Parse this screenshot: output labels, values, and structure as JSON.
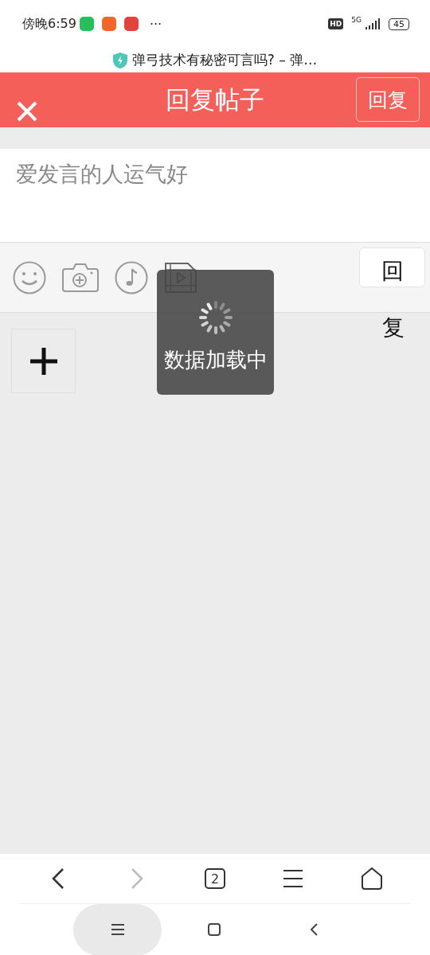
{
  "status_bar": {
    "time": "傍晚6:59",
    "more": "···",
    "hd_badge": "HD",
    "network": "5G",
    "battery": "45"
  },
  "page_title": "弹弓技术有秘密可言吗? – 弹…",
  "header": {
    "title": "回复帖子",
    "reply_button": "回复"
  },
  "composer": {
    "placeholder": "爱发言的人运气好"
  },
  "side_button": {
    "line_1": "回",
    "line_2": "复"
  },
  "toolbar": [
    {
      "kind": "emoji"
    },
    {
      "kind": "camera"
    },
    {
      "kind": "music"
    },
    {
      "kind": "video"
    }
  ],
  "toast": {
    "text": "数据加载中"
  },
  "browser_nav": [
    {
      "kind": "back",
      "disabled": false
    },
    {
      "kind": "forward",
      "disabled": true
    },
    {
      "kind": "tabs",
      "count": "2",
      "disabled": false
    },
    {
      "kind": "menu",
      "disabled": false
    },
    {
      "kind": "home",
      "disabled": false
    }
  ]
}
